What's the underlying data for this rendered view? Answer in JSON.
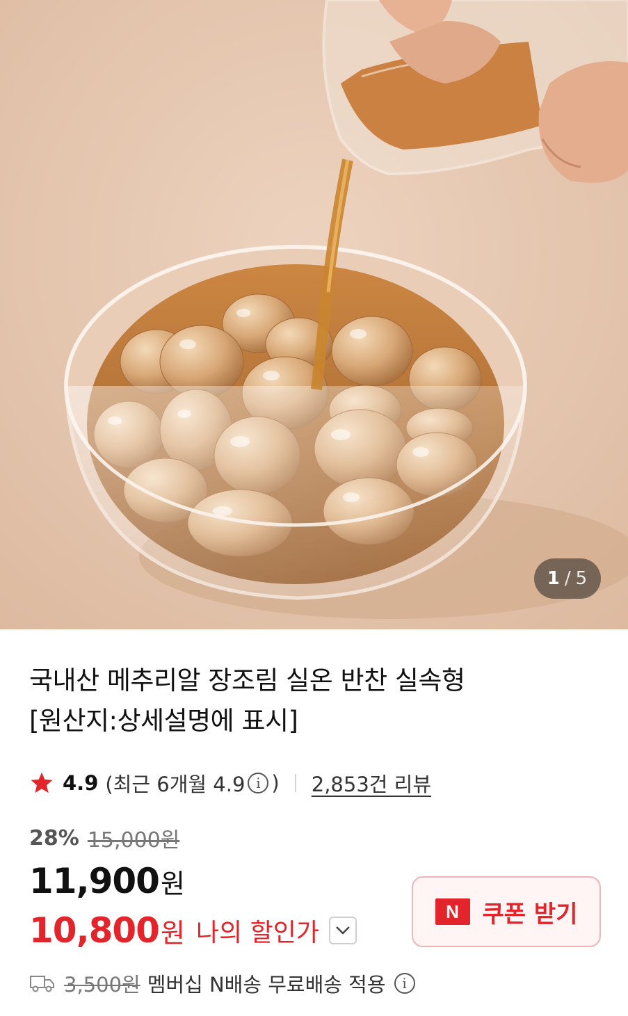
{
  "gallery": {
    "current": "1",
    "separator": "/",
    "total": "5"
  },
  "product": {
    "title_line1": "국내산 메추리알 장조림 실온 반찬 실속형",
    "title_line2": "[원산지:상세설명에 표시]"
  },
  "rating": {
    "score": "4.9",
    "recent_prefix": "(최근 6개월 4.9",
    "info_glyph": "i",
    "recent_suffix": ")",
    "reviews": "2,853건 리뷰"
  },
  "pricing": {
    "discount_rate": "28%",
    "original_price": "15,000원",
    "price": "11,900",
    "currency": "원",
    "my_price": "10,800",
    "my_price_currency": "원",
    "my_price_label": "나의 할인가"
  },
  "coupon": {
    "badge": "N",
    "label": "쿠폰 받기"
  },
  "shipping": {
    "fee": "3,500원",
    "text": "멤버십 N배송 무료배송 적용",
    "info_glyph": "i"
  },
  "colors": {
    "accent_red": "#e3242b",
    "coupon_bg": "#fff5f5",
    "coupon_border": "#f3b4b7"
  },
  "icons": [
    "star-icon",
    "info-icon",
    "chevron-down-icon",
    "naver-n-icon",
    "truck-icon"
  ]
}
